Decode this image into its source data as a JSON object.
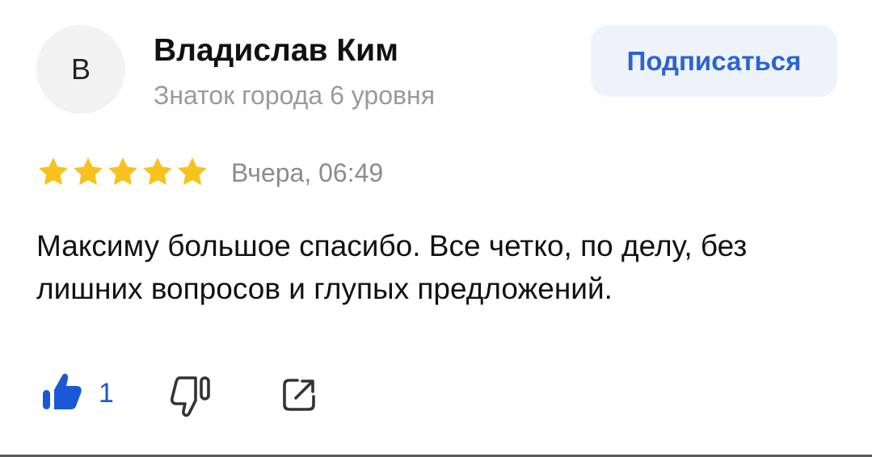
{
  "author": {
    "initial": "В",
    "name": "Владислав Ким",
    "level": "Знаток города 6 уровня"
  },
  "subscribe_label": "Подписаться",
  "review": {
    "rating": 5,
    "max_rating": 5,
    "date": "Вчера, 06:49",
    "text": "Максиму большое спасибо. Все четко, по делу, без лишних вопросов и глупых предложений."
  },
  "actions": {
    "like_count": "1",
    "like_icon": "thumbs-up-icon",
    "dislike_icon": "thumbs-down-icon",
    "share_icon": "share-icon"
  },
  "colors": {
    "star": "#f8c21c",
    "accent": "#2a63d4",
    "like": "#1b58d6",
    "subscribe_bg": "#eef3fb"
  }
}
